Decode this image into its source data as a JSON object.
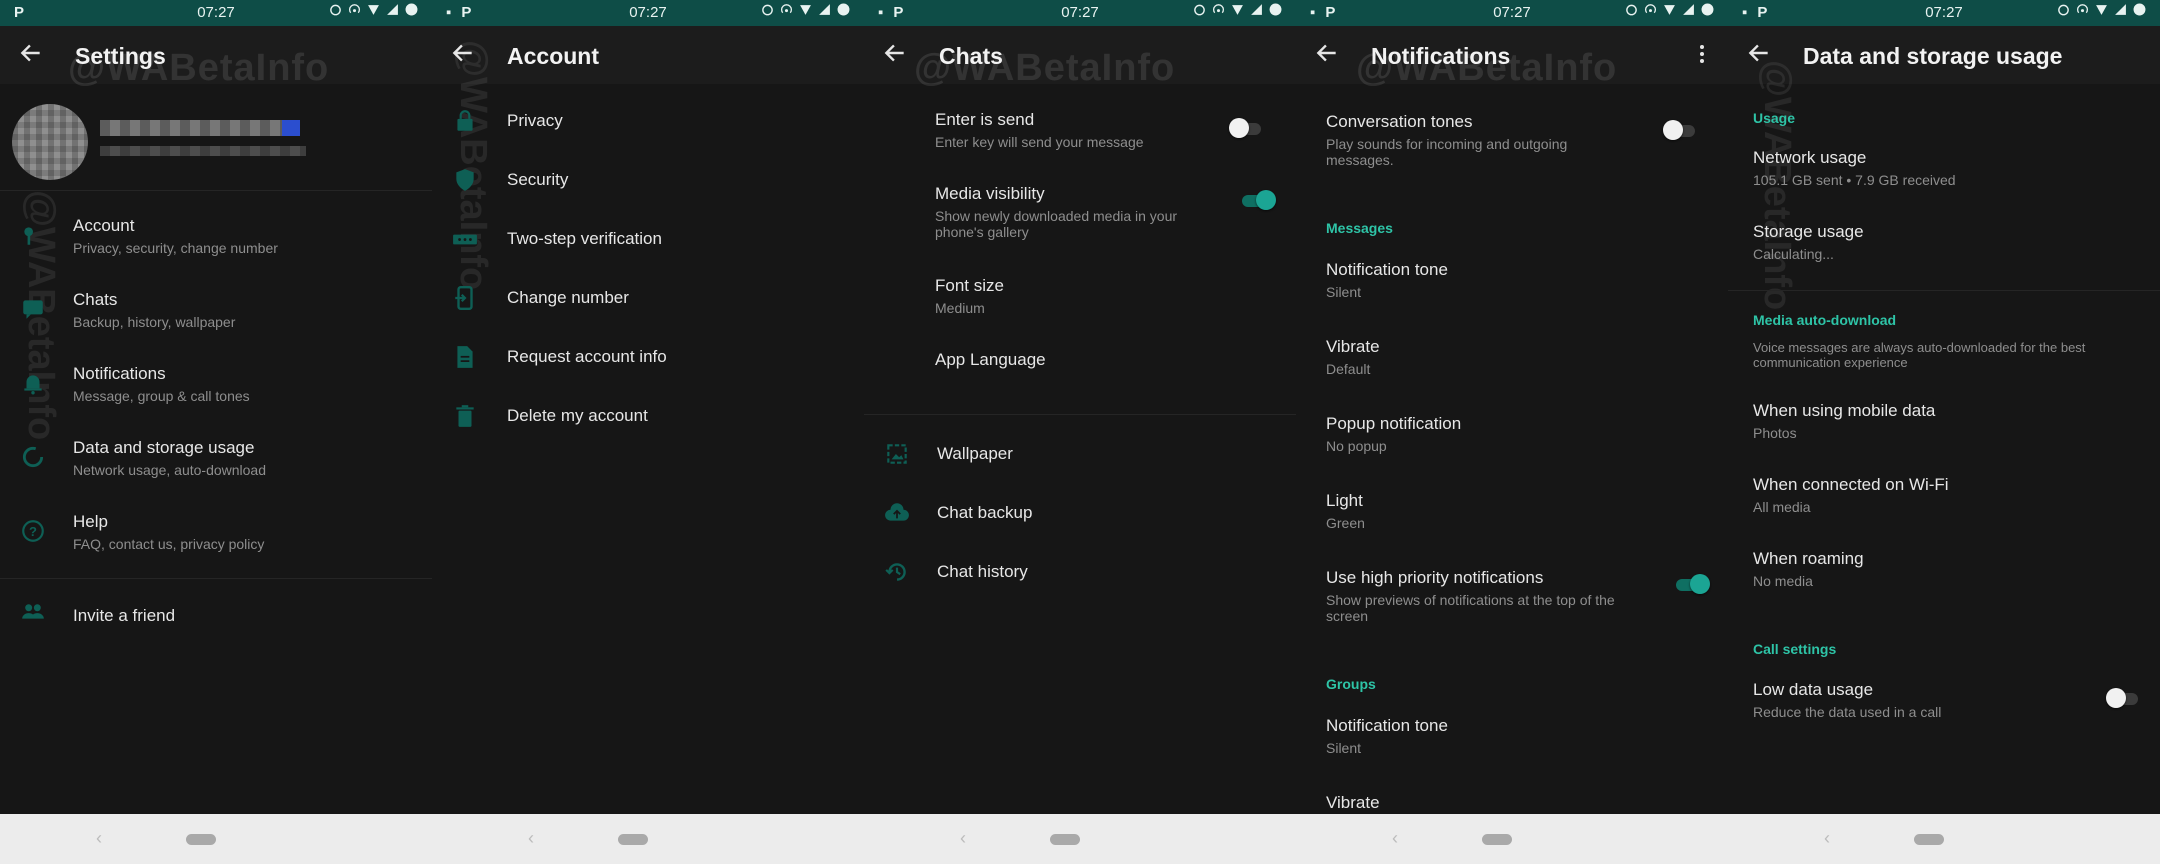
{
  "status": {
    "time": "07:27",
    "battery": "84"
  },
  "watermark": "@WABetaInfo",
  "colors": {
    "accent": "#2ec4a7",
    "status_bar": "#0e4d47",
    "background": "#161616"
  },
  "settings": {
    "title": "Settings",
    "items": [
      {
        "label": "Account",
        "sub": "Privacy, security, change number",
        "icon": "key-icon"
      },
      {
        "label": "Chats",
        "sub": "Backup, history, wallpaper",
        "icon": "chat-icon"
      },
      {
        "label": "Notifications",
        "sub": "Message, group & call tones",
        "icon": "bell-icon"
      },
      {
        "label": "Data and storage usage",
        "sub": "Network usage, auto-download",
        "icon": "data-usage-icon"
      },
      {
        "label": "Help",
        "sub": "FAQ, contact us, privacy policy",
        "icon": "help-icon"
      }
    ],
    "invite": "Invite a friend"
  },
  "account": {
    "title": "Account",
    "items": [
      {
        "label": "Privacy",
        "icon": "lock-icon"
      },
      {
        "label": "Security",
        "icon": "shield-icon"
      },
      {
        "label": "Two-step verification",
        "icon": "dots-icon"
      },
      {
        "label": "Change number",
        "icon": "phone-change-icon"
      },
      {
        "label": "Request account info",
        "icon": "document-icon"
      },
      {
        "label": "Delete my account",
        "icon": "trash-icon"
      }
    ]
  },
  "chats": {
    "title": "Chats",
    "enter_send": {
      "label": "Enter is send",
      "sub": "Enter key will send your message",
      "enabled": false
    },
    "media_visibility": {
      "label": "Media visibility",
      "sub": "Show newly downloaded media in your phone's gallery",
      "enabled": true
    },
    "font_size": {
      "label": "Font size",
      "value": "Medium"
    },
    "app_language": {
      "label": "App Language"
    },
    "items": [
      {
        "label": "Wallpaper",
        "icon": "wallpaper-icon"
      },
      {
        "label": "Chat backup",
        "icon": "cloud-upload-icon"
      },
      {
        "label": "Chat history",
        "icon": "history-icon"
      }
    ]
  },
  "notifications": {
    "title": "Notifications",
    "conversation_tones": {
      "label": "Conversation tones",
      "sub": "Play sounds for incoming and outgoing messages.",
      "enabled": false
    },
    "messages_header": "Messages",
    "messages": [
      {
        "label": "Notification tone",
        "value": "Silent"
      },
      {
        "label": "Vibrate",
        "value": "Default"
      },
      {
        "label": "Popup notification",
        "value": "No popup"
      },
      {
        "label": "Light",
        "value": "Green"
      }
    ],
    "high_priority": {
      "label": "Use high priority notifications",
      "sub": "Show previews of notifications at the top of the screen",
      "enabled": true
    },
    "groups_header": "Groups",
    "groups": [
      {
        "label": "Notification tone",
        "value": "Silent"
      },
      {
        "label": "Vibrate",
        "value": ""
      }
    ]
  },
  "data_storage": {
    "title": "Data and storage usage",
    "usage_header": "Usage",
    "network_usage": {
      "label": "Network usage",
      "value": "105.1 GB sent • 7.9 GB received"
    },
    "storage_usage": {
      "label": "Storage usage",
      "value": "Calculating..."
    },
    "auto_download_header": "Media auto-download",
    "auto_download_note": "Voice messages are always auto-downloaded for the best communication experience",
    "mobile_data": {
      "label": "When using mobile data",
      "value": "Photos"
    },
    "wifi": {
      "label": "When connected on Wi-Fi",
      "value": "All media"
    },
    "roaming": {
      "label": "When roaming",
      "value": "No media"
    },
    "call_header": "Call settings",
    "low_data": {
      "label": "Low data usage",
      "sub": "Reduce the data used in a call",
      "enabled": false
    }
  }
}
